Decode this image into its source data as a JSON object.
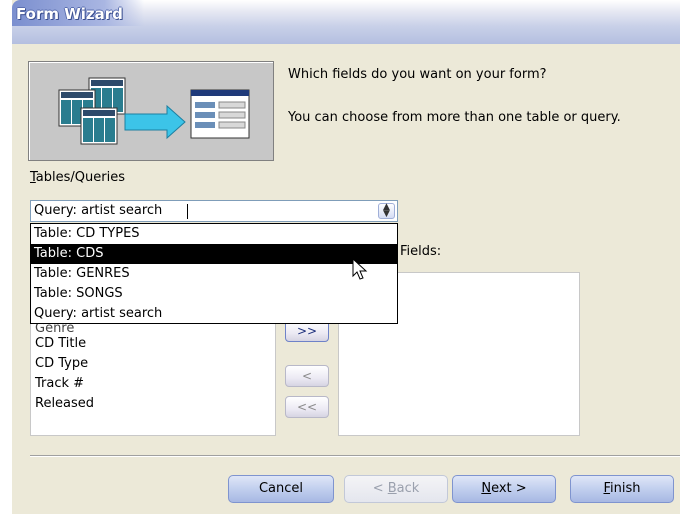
{
  "window": {
    "title": "Form Wizard"
  },
  "description": {
    "line1": "Which fields do you want on your form?",
    "line2": "You can choose from more than one table or query."
  },
  "tables_queries": {
    "label_accel": "T",
    "label_rest": "ables/Queries",
    "selected_value": "Query: artist search",
    "options": [
      "Table: CD TYPES",
      "Table: CDS",
      "Table: GENRES",
      "Table: SONGS",
      "Query: artist search"
    ],
    "highlighted_option": "Table: CDS"
  },
  "available_fields": {
    "partial_item": "Genre",
    "items": [
      "CD Title",
      "CD Type",
      "Track #",
      "Released"
    ]
  },
  "selected_fields": {
    "label_visible": "Fields:"
  },
  "move_buttons": {
    "add_all": ">>",
    "remove_one": "<",
    "remove_all": "<<"
  },
  "buttons": {
    "cancel": "Cancel",
    "back_accel": "B",
    "back_prefix": "< ",
    "back_rest": "ack",
    "next_accel": "N",
    "next_rest": "ext >",
    "finish_accel": "F",
    "finish_rest": "inish"
  },
  "colors": {
    "selection": "#000000",
    "window_bg": "#ece9d8",
    "accent": "#3b4f8f"
  }
}
